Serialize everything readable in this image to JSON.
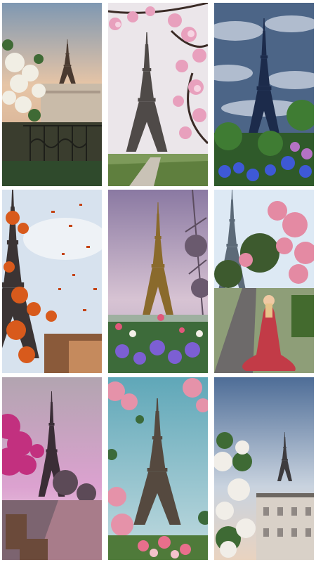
{
  "gallery": {
    "tiles": [
      {
        "name": "tile-eiffel-white-roses-balcony",
        "colors": {
          "sky": "#c9b4a4",
          "accent": "#f2efe8"
        }
      },
      {
        "name": "tile-eiffel-pink-magnolia",
        "colors": {
          "sky": "#ece7ec",
          "accent": "#e8a0bd"
        }
      },
      {
        "name": "tile-eiffel-dramatic-clouds-blue-flowers",
        "colors": {
          "sky": "#5d7393",
          "accent": "#3e59d6"
        }
      },
      {
        "name": "tile-eiffel-autumn-leaves",
        "colors": {
          "sky": "#cfdbe7",
          "accent": "#d85a1c"
        }
      },
      {
        "name": "tile-eiffel-purple-sky-garden",
        "colors": {
          "sky": "#b7a1bd",
          "accent": "#7c5fd3"
        }
      },
      {
        "name": "tile-eiffel-woman-red-dress",
        "colors": {
          "sky": "#dce8f4",
          "accent": "#c23b47"
        }
      },
      {
        "name": "tile-eiffel-pink-sunset-bench",
        "colors": {
          "sky": "#d79bd7",
          "accent": "#c2307f"
        }
      },
      {
        "name": "tile-eiffel-teal-sky-cherry-blossoms",
        "colors": {
          "sky": "#8fc7d4",
          "accent": "#e592a9"
        }
      },
      {
        "name": "tile-eiffel-rooftops-white-roses",
        "colors": {
          "sky": "#a7bdd7",
          "accent": "#f1eee8"
        }
      }
    ]
  }
}
